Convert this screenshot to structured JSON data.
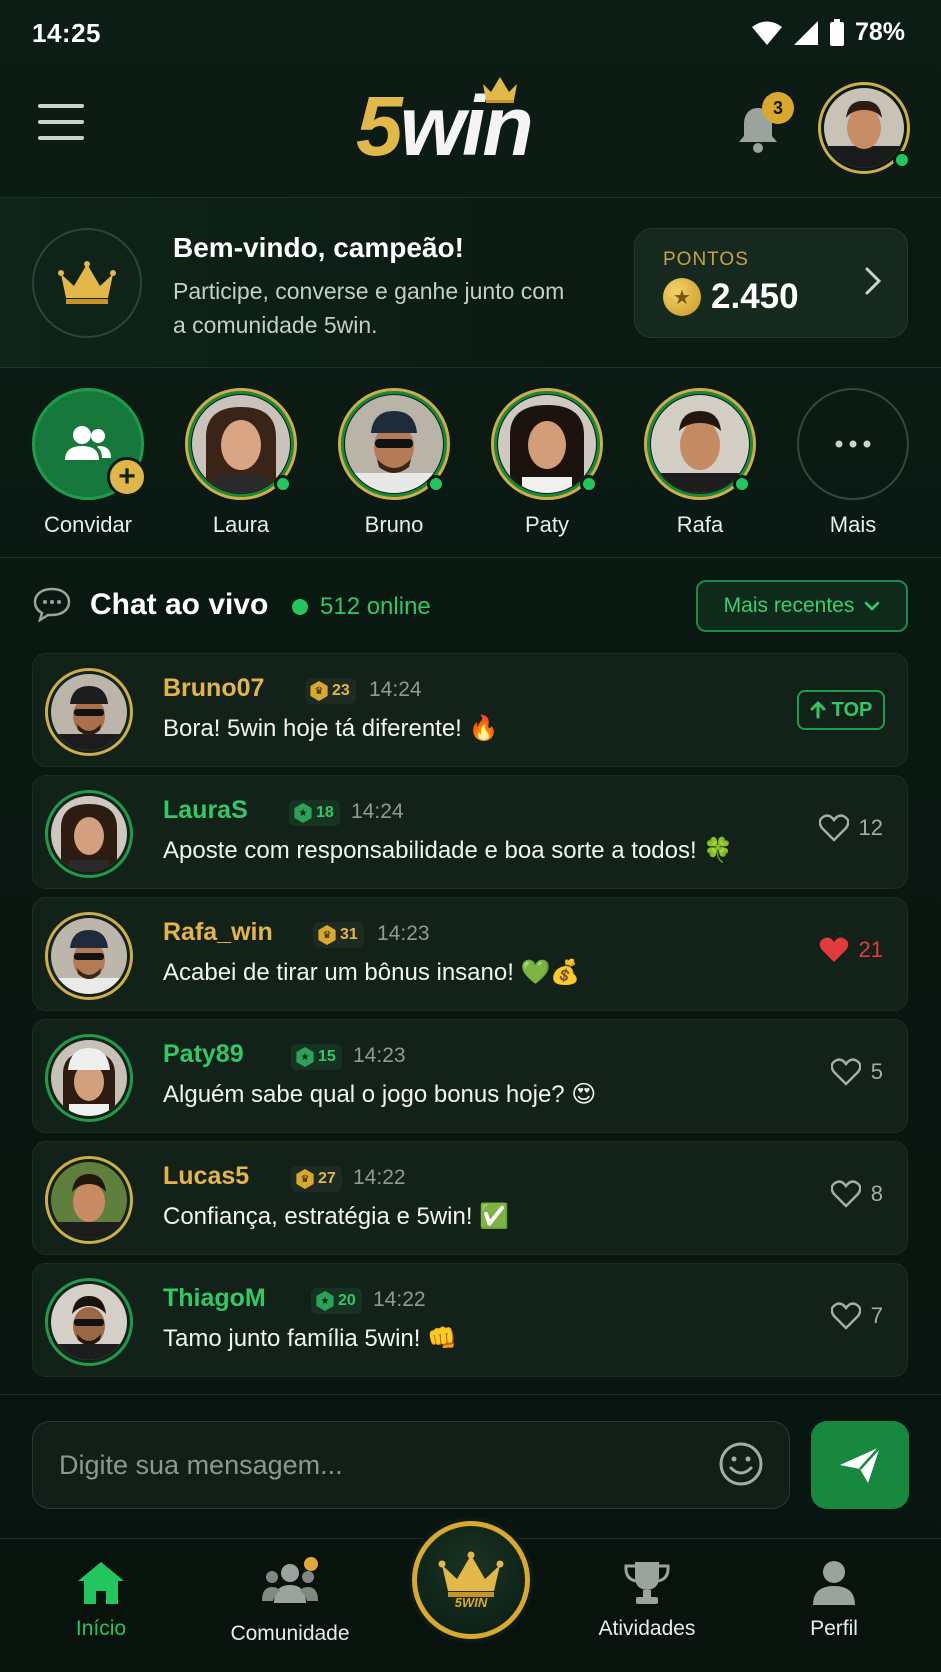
{
  "status_bar": {
    "time": "14:25",
    "battery": "78%"
  },
  "header": {
    "logo_five": "5",
    "logo_win": "win",
    "notification_count": "3"
  },
  "welcome": {
    "title": "Bem-vindo, campeão!",
    "subtitle": "Participe, converse e ganhe junto com a comunidade 5win.",
    "points_label": "PONTOS",
    "points_value": "2.450"
  },
  "stories": {
    "invite_label": "Convidar",
    "plus": "+",
    "users": [
      {
        "name": "Laura"
      },
      {
        "name": "Bruno"
      },
      {
        "name": "Paty"
      },
      {
        "name": "Rafa"
      }
    ],
    "more_label": "Mais"
  },
  "chat": {
    "title": "Chat ao vivo",
    "online": "512 online",
    "sort_label": "Mais recentes",
    "messages": [
      {
        "user": "Bruno07",
        "level": "23",
        "time": "14:24",
        "text": "Bora! 5win hoje tá diferente! 🔥",
        "badge": "TOP",
        "tier": "gold"
      },
      {
        "user": "LauraS",
        "level": "18",
        "time": "14:24",
        "text": "Aposte com responsabilidade e boa sorte a todos! 🍀",
        "likes": "12",
        "tier": "green"
      },
      {
        "user": "Rafa_win",
        "level": "31",
        "time": "14:23",
        "text": "Acabei de tirar um bônus insano! 💚💰",
        "likes": "21",
        "tier": "gold",
        "liked": true
      },
      {
        "user": "Paty89",
        "level": "15",
        "time": "14:23",
        "text": "Alguém sabe qual o jogo bonus hoje? 😍",
        "likes": "5",
        "tier": "green"
      },
      {
        "user": "Lucas5",
        "level": "27",
        "time": "14:22",
        "text": "Confiança, estratégia e 5win! ✅",
        "likes": "8",
        "tier": "gold"
      },
      {
        "user": "ThiagoM",
        "level": "20",
        "time": "14:22",
        "text": "Tamo junto família 5win! 👊",
        "likes": "7",
        "tier": "green"
      }
    ]
  },
  "composer": {
    "placeholder": "Digite sua mensagem..."
  },
  "nav": {
    "home": "Início",
    "community": "Comunidade",
    "center_text": "5WIN",
    "activities": "Atividades",
    "profile": "Perfil"
  },
  "colors": {
    "accent_green": "#22c55e",
    "gold": "#d9a82f",
    "background": "#0b1a13",
    "like_red": "#e23b3b"
  },
  "icons": [
    "menu-icon",
    "bell-icon",
    "crown-icon",
    "coin-star-icon",
    "chevron-right-icon",
    "users-icon",
    "dots-icon",
    "chat-bubble-icon",
    "chevron-down-icon",
    "arrow-up-icon",
    "heart-icon",
    "emoji-icon",
    "send-icon",
    "home-icon",
    "community-icon",
    "trophy-icon",
    "person-icon"
  ]
}
